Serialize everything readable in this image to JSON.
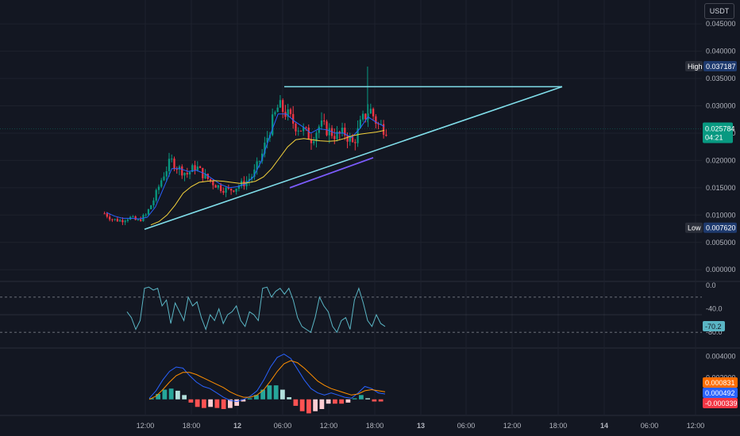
{
  "header": {
    "currency_label": "USDT"
  },
  "colors": {
    "background": "#131722",
    "grid": "#1e222d",
    "separator": "#2a2e39",
    "up": "#089981",
    "down": "#f23645",
    "ema_fast": "#2962ff",
    "ema_slow": "#f5d33c",
    "trendline": "#80deea",
    "rsi": "#5ab5c4",
    "macd": "#2962ff",
    "signal": "#ff8f00",
    "accent": "#7c5cff"
  },
  "chart_data": [
    {
      "type": "candlestick",
      "pair": "USDT",
      "x_ticks": [
        "12:00",
        "18:00",
        "12",
        "06:00",
        "12:00",
        "18:00",
        "13",
        "06:00",
        "12:00",
        "18:00",
        "14",
        "06:00",
        "12:00"
      ],
      "y_ticks": [
        "0.045000",
        "0.040000",
        "0.035000",
        "0.030000",
        "0.025000",
        "0.020000",
        "0.015000",
        "0.010000",
        "0.005000",
        "0.000000"
      ],
      "ylim": [
        -0.002,
        0.0485
      ],
      "high": {
        "label": "High",
        "value": "0.037187",
        "y": 0.037187
      },
      "low": {
        "label": "Low",
        "value": "0.007620",
        "y": 0.00762
      },
      "last": {
        "value": "0.025784",
        "countdown": "04:21",
        "y": 0.025784
      },
      "annotations": [
        {
          "type": "horizontal_line",
          "y": 0.0335,
          "x_from": "06:00",
          "x_to": "17-day 18:00"
        },
        {
          "type": "rising_trendline",
          "y_from": 0.0074,
          "y_to": 0.0335
        }
      ],
      "series": [
        {
          "name": "price",
          "close_trend": [
            0.0103,
            0.0092,
            0.009,
            0.0096,
            0.0089,
            0.01,
            0.013,
            0.017,
            0.02,
            0.0185,
            0.0175,
            0.019,
            0.0172,
            0.016,
            0.015,
            0.0145,
            0.0152,
            0.016,
            0.0175,
            0.021,
            0.026,
            0.03,
            0.0285,
            0.0265,
            0.0255,
            0.024,
            0.0265,
            0.0255,
            0.0245,
            0.025,
            0.023,
            0.027,
            0.0295,
            0.0265,
            0.0258
          ]
        },
        {
          "name": "EMA fast",
          "trend": [
            0.0105,
            0.0098,
            0.0094,
            0.0094,
            0.0093,
            0.0096,
            0.0115,
            0.015,
            0.0185,
            0.0185,
            0.018,
            0.0182,
            0.0176,
            0.0166,
            0.0156,
            0.015,
            0.0152,
            0.0157,
            0.017,
            0.02,
            0.0245,
            0.0285,
            0.0285,
            0.0272,
            0.0262,
            0.025,
            0.0258,
            0.0256,
            0.025,
            0.025,
            0.0242,
            0.0258,
            0.028,
            0.027,
            0.0262
          ]
        },
        {
          "name": "EMA slow",
          "trend": [
            0.0082,
            0.0088,
            0.01,
            0.0118,
            0.014,
            0.0152,
            0.016,
            0.0162,
            0.0163,
            0.0162,
            0.016,
            0.0158,
            0.0159,
            0.0162,
            0.017,
            0.0185,
            0.0205,
            0.0225,
            0.0238,
            0.024,
            0.0238,
            0.0236,
            0.0235,
            0.0236,
            0.024,
            0.0245,
            0.0248,
            0.025,
            0.0252,
            0.0255
          ]
        }
      ]
    },
    {
      "type": "line",
      "name": "oscillator",
      "y_ticks": [
        "0.0",
        "-40.0",
        "-80.0"
      ],
      "ylim": [
        -100,
        0
      ],
      "last": {
        "value": "-70.2",
        "y": -70.2
      },
      "bands": [
        -20,
        -80
      ],
      "mid": -50,
      "values": [
        -45,
        -55,
        -75,
        -60,
        -5,
        -3,
        -8,
        -5,
        -35,
        -25,
        -65,
        -30,
        -45,
        -60,
        -20,
        -35,
        -28,
        -55,
        -75,
        -50,
        -60,
        -40,
        -65,
        -50,
        -45,
        -35,
        -60,
        -70,
        -45,
        -50,
        -60,
        -5,
        -3,
        -20,
        -10,
        -5,
        -15,
        -5,
        -25,
        -55,
        -70,
        -75,
        -80,
        -55,
        -20,
        -35,
        -45,
        -70,
        -80,
        -60,
        -55,
        -75,
        -25,
        -5,
        -30,
        -60,
        -70,
        -50,
        -65,
        -70
      ]
    },
    {
      "type": "histogram",
      "name": "MACD",
      "y_ticks": [
        "0.004000",
        "0.002000",
        "0.000000"
      ],
      "ylim": [
        -0.0009,
        0.0044
      ],
      "tags": [
        {
          "value": "0.000831",
          "y": 0.000831,
          "color": "#ff6d00"
        },
        {
          "value": "0.000492",
          "y": 0.000492,
          "color": "#2962ff"
        },
        {
          "value": "-0.000339",
          "y": -0.000339,
          "color": "#f23645"
        }
      ],
      "macd": [
        0.0001,
        0.0008,
        0.0018,
        0.0026,
        0.003,
        0.0029,
        0.0022,
        0.0016,
        0.0012,
        0.001,
        0.0006,
        0.0002,
        -0.0001,
        -0.0002,
        0.0,
        0.0003,
        0.0008,
        0.0018,
        0.003,
        0.0039,
        0.0042,
        0.0038,
        0.0028,
        0.0018,
        0.001,
        0.0006,
        0.0004,
        0.0006,
        0.0004,
        0.0002,
        0.0001,
        0.0006,
        0.0012,
        0.001,
        0.0006,
        0.0005
      ],
      "signal": [
        0.0,
        0.0003,
        0.0009,
        0.0016,
        0.0022,
        0.0025,
        0.0025,
        0.0023,
        0.002,
        0.0017,
        0.0014,
        0.0011,
        0.0007,
        0.0004,
        0.0002,
        0.0002,
        0.0004,
        0.0009,
        0.0017,
        0.0026,
        0.0033,
        0.0036,
        0.0034,
        0.0029,
        0.0023,
        0.0017,
        0.0013,
        0.001,
        0.0008,
        0.0006,
        0.0004,
        0.0005,
        0.0008,
        0.0009,
        0.0008,
        0.0007
      ],
      "histogram": [
        0.0001,
        0.0005,
        0.0009,
        0.001,
        0.0008,
        0.0004,
        -0.0003,
        -0.0007,
        -0.0008,
        -0.0007,
        -0.0008,
        -0.0009,
        -0.0008,
        -0.0006,
        -0.0002,
        0.0001,
        0.0004,
        0.0009,
        0.0013,
        0.0013,
        0.0009,
        0.0002,
        -0.0006,
        -0.0011,
        -0.0013,
        -0.0011,
        -0.0009,
        -0.0004,
        -0.0004,
        -0.0004,
        -0.0003,
        0.0001,
        0.0004,
        0.0001,
        -0.0002,
        -0.0002
      ]
    }
  ]
}
